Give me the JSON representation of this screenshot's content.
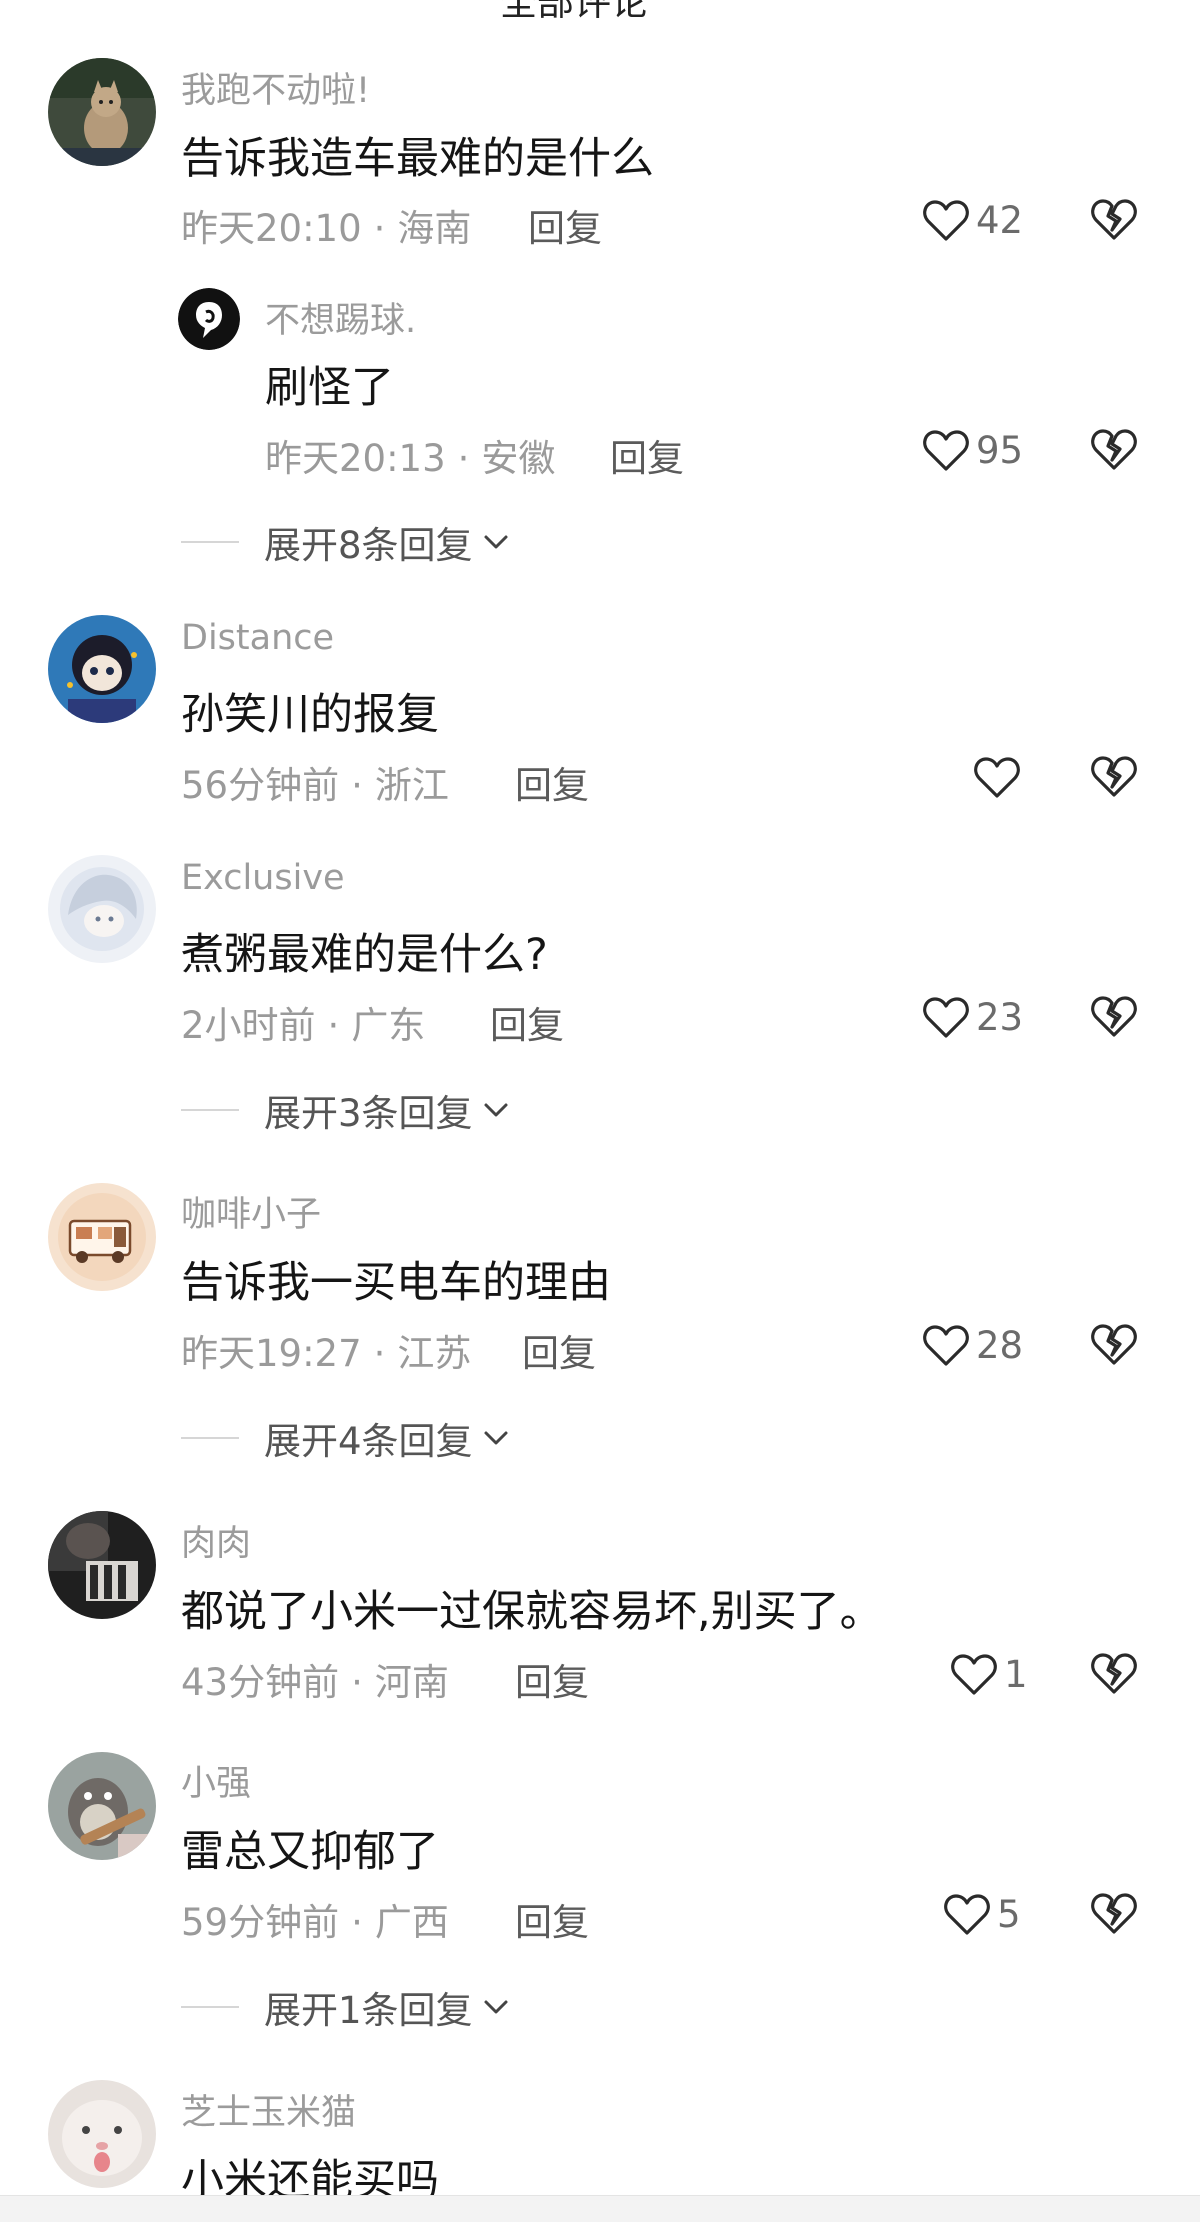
{
  "header": {
    "cut_title": "全部评论"
  },
  "colors": {
    "username": "#9b9b9b",
    "meta": "#9a9a9a",
    "text": "#151515"
  },
  "comments": [
    {
      "user": "我跑不动啦!",
      "text": "告诉我造车最难的是什么",
      "time": "昨天20:10",
      "sep": "·",
      "region": "海南",
      "reply": "回复",
      "likes": "42",
      "avatar": "cat-avatar-icon",
      "replies": [
        {
          "user": "不想踢球.",
          "text": "刷怪了",
          "time": "昨天20:13",
          "sep": "·",
          "region": "安徽",
          "reply": "回复",
          "likes": "95",
          "avatar": "black-logo-avatar-icon"
        }
      ],
      "expand": "展开8条回复"
    },
    {
      "user": "Distance",
      "text": "孙笑川的报复",
      "time": "56分钟前",
      "sep": "·",
      "region": "浙江",
      "reply": "回复",
      "likes": "",
      "avatar": "anime-girl-avatar-icon"
    },
    {
      "user": "Exclusive",
      "text": "煮粥最难的是什么?",
      "time": "2小时前",
      "sep": "·",
      "region": "广东",
      "reply": "回复",
      "likes": "23",
      "avatar": "white-hair-avatar-icon",
      "expand": "展开3条回复"
    },
    {
      "user": "咖啡小子",
      "text": "告诉我一买电车的理由",
      "time": "昨天19:27",
      "sep": "·",
      "region": "江苏",
      "reply": "回复",
      "likes": "28",
      "avatar": "coffee-truck-avatar-icon",
      "expand": "展开4条回复"
    },
    {
      "user": "肉肉",
      "text": "都说了小米一过保就容易坏,别买了。",
      "time": "43分钟前",
      "sep": "·",
      "region": "河南",
      "reply": "回复",
      "likes": "1",
      "avatar": "dark-photo-avatar-icon"
    },
    {
      "user": "小强",
      "text": "雷总又抑郁了",
      "time": "59分钟前",
      "sep": "·",
      "region": "广西",
      "reply": "回复",
      "likes": "5",
      "avatar": "totoro-guitar-avatar-icon",
      "expand": "展开1条回复"
    },
    {
      "user": "芝士玉米猫",
      "text": "小米还能买吗",
      "avatar": "white-cat-avatar-icon"
    }
  ]
}
